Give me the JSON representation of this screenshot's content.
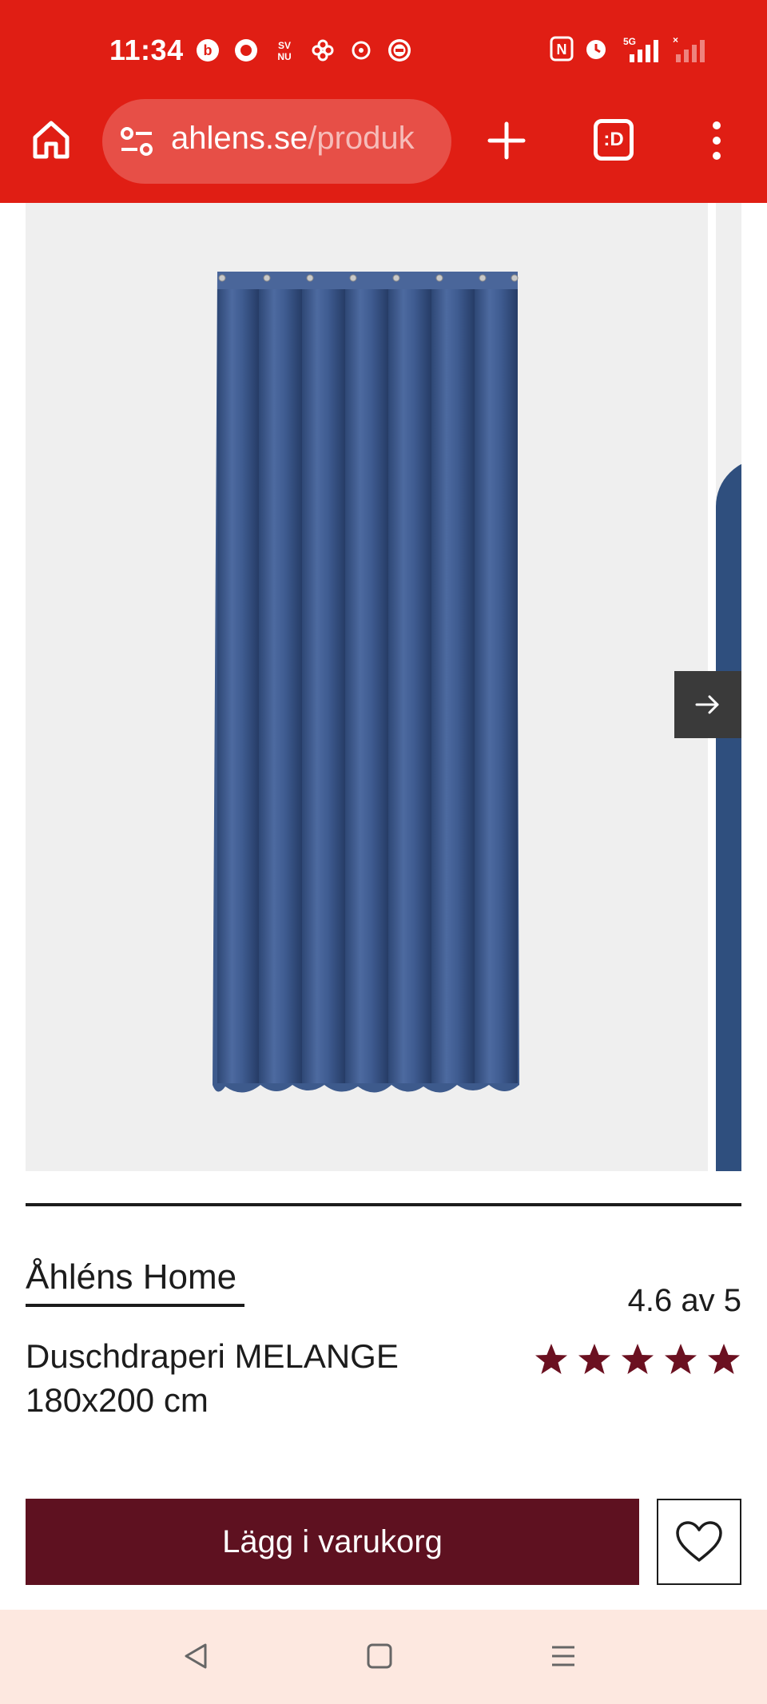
{
  "status_bar": {
    "time": "11:34",
    "left_icons": [
      "b-app-icon",
      "circle-app-icon",
      "sv-nu-app-icon",
      "pinwheel-app-icon",
      "chat-app-icon",
      "badge-app-icon"
    ],
    "right_icons": [
      "nfc-icon",
      "alarm-icon",
      "signal-5g-icon",
      "signal-icon"
    ],
    "network_label": "5G"
  },
  "browser": {
    "url_host": "ahlens.se",
    "url_path": "/produk",
    "tab_button_label": ":D"
  },
  "product": {
    "brand": "Åhléns Home",
    "name": "Duschdraperi MELANGE 180x200 cm",
    "rating_text": "4.6 av 5",
    "rating_value": 4.6,
    "rating_max": 5,
    "star_color": "#6b1020",
    "image_subject": "blue shower curtain"
  },
  "actions": {
    "add_to_cart": "Lägg i varukorg"
  },
  "colors": {
    "browser_red": "#e01e14",
    "cart_button": "#5e1120",
    "curtain_blue": "#3d5a8c",
    "nav_bar": "#fde8e0"
  }
}
